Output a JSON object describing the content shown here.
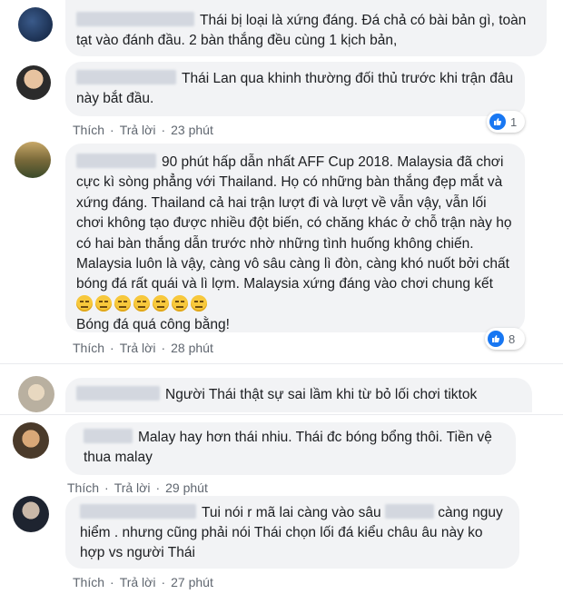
{
  "comments": [
    {
      "text": "Thái bị loại là xứng đáng. Đá chả có bài bản gì, toàn tạt vào đánh đầu. 2 bàn thắng đều cùng 1 kịch bản,"
    },
    {
      "text": "Thái Lan qua khinh thường đối thủ trước khi trận đâu này bắt đầu.",
      "actions": {
        "like": "Thích",
        "reply": "Trả lời",
        "time": "23 phút"
      },
      "reaction_count": "1"
    },
    {
      "text": "90 phút hấp dẫn nhất AFF Cup 2018. Malaysia đã chơi cực kì sòng phẳng với Thailand. Họ có những bàn thắng đẹp mắt và xứng đáng. Thailand cả hai trận lượt đi và lượt về vẫn vậy, vẫn lối chơi không tạo được nhiều đột biến, có chăng khác ở chỗ trận này họ có hai bàn thắng dẫn trước nhờ những tình huống không chiến. Malaysia luôn là vậy, càng vô sâu càng lì đòn, càng khó nuốt bởi chất bóng đá rất quái và lì lợm. Malaysia xứng đáng vào chơi chung kết",
      "text2": "Bóng đá quá công bằng!",
      "actions": {
        "like": "Thích",
        "reply": "Trả lời",
        "time": "28 phút"
      },
      "reaction_count": "8"
    },
    {
      "text": "Người Thái thật sự sai lầm khi từ bỏ lối chơi tiktok"
    },
    {
      "text": "Malay hay hơn thái nhiu. Thái đc bóng bổng thôi. Tiền vệ thua malay",
      "actions": {
        "like": "Thích",
        "reply": "Trả lời",
        "time": "29 phút"
      }
    },
    {
      "text_a": "Tui nói r mã lai càng vào sâu",
      "text_b": "càng nguy hiểm . nhưng cũng phải nói Thái chọn lối đá kiểu châu âu này ko hợp vs người Thái",
      "actions": {
        "like": "Thích",
        "reply": "Trả lời",
        "time": "27 phút"
      }
    }
  ],
  "colors": {
    "bubble": "#f2f3f5",
    "link": "#606770",
    "like_blue": "#1877f2"
  }
}
